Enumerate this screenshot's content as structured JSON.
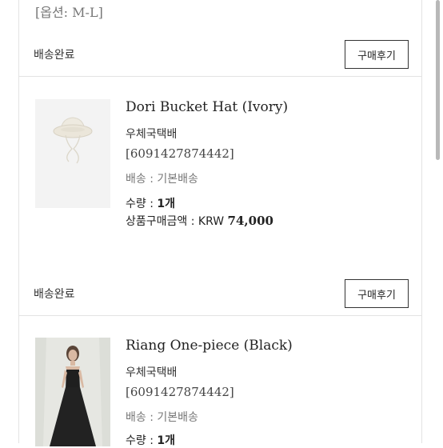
{
  "option_text": "[옵션: M-L]",
  "orders": [
    {
      "status": "배송완료",
      "review_button": "구매후기",
      "product": {
        "name": "Dori Bucket Hat (Ivory)",
        "carrier": "우체국택배",
        "tracking": "[6091427874442]",
        "shipping_label": "배송 : ",
        "shipping_value": "기본배송",
        "qty_label": "수량 : ",
        "qty_value": "1개",
        "price_label": "상품구매금액 : ",
        "price_currency": "KRW ",
        "price_value": "74,000"
      }
    },
    {
      "status": "배송완료",
      "review_button": "구매후기",
      "product": {
        "name": "Riang One-piece (Black)",
        "carrier": "우체국택배",
        "tracking": "[6091427874442]",
        "shipping_label": "배송 : ",
        "shipping_value": "기본배송",
        "qty_label": "수량 : ",
        "qty_value": "1개"
      }
    }
  ]
}
